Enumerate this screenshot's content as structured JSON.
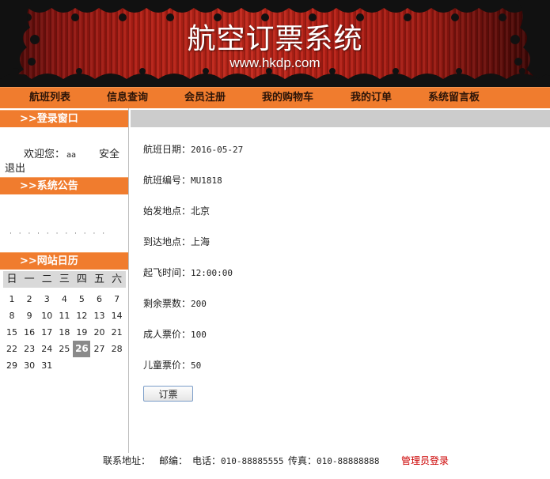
{
  "banner": {
    "title": "航空订票系统",
    "url": "www.hkdp.com"
  },
  "nav": {
    "items": [
      "航班列表",
      "信息查询",
      "会员注册",
      "我的购物车",
      "我的订单",
      "系统留言板"
    ]
  },
  "sidebar": {
    "login_title": ">>登录窗口",
    "welcome_label": "欢迎您：",
    "username": "aa",
    "logout_part1": "安全",
    "logout_part2": "退出",
    "notice_title": ">>系统公告",
    "notice_text": "· · ·    ·  ·   · · ·  ·  ·  ·",
    "calendar_title": ">>网站日历",
    "calendar": {
      "weekdays": [
        "日",
        "一",
        "二",
        "三",
        "四",
        "五",
        "六"
      ],
      "weeks": [
        [
          "1",
          "2",
          "3",
          "4",
          "5",
          "6",
          "7"
        ],
        [
          "8",
          "9",
          "10",
          "11",
          "12",
          "13",
          "14"
        ],
        [
          "15",
          "16",
          "17",
          "18",
          "19",
          "20",
          "21"
        ],
        [
          "22",
          "23",
          "24",
          "25",
          "26",
          "27",
          "28"
        ],
        [
          "29",
          "30",
          "31",
          "",
          "",
          "",
          ""
        ]
      ],
      "today": "26"
    }
  },
  "flight": {
    "date_label": "航班日期：",
    "date_value": "2016-05-27",
    "number_label": "航班编号：",
    "number_value": "MU1818",
    "origin_label": "始发地点：",
    "origin_value": "北京",
    "dest_label": "到达地点：",
    "dest_value": "上海",
    "time_label": "起飞时间：",
    "time_value": "12:00:00",
    "seats_label": "剩余票数：",
    "seats_value": "200",
    "adult_label": "成人票价：",
    "adult_value": "100",
    "child_label": "儿童票价：",
    "child_value": "50",
    "order_button": "订票"
  },
  "footer": {
    "address_label": "联系地址：",
    "zip_label": "邮编：",
    "phone_label": "电话：",
    "phone_value": "010-88885555",
    "fax_label": "传真：",
    "fax_value": "010-88888888",
    "admin_login": "管理员登录"
  },
  "colors": {
    "accent_orange": "#f07c2e",
    "banner_red": "#b31e14",
    "admin_link": "#cc0000"
  }
}
